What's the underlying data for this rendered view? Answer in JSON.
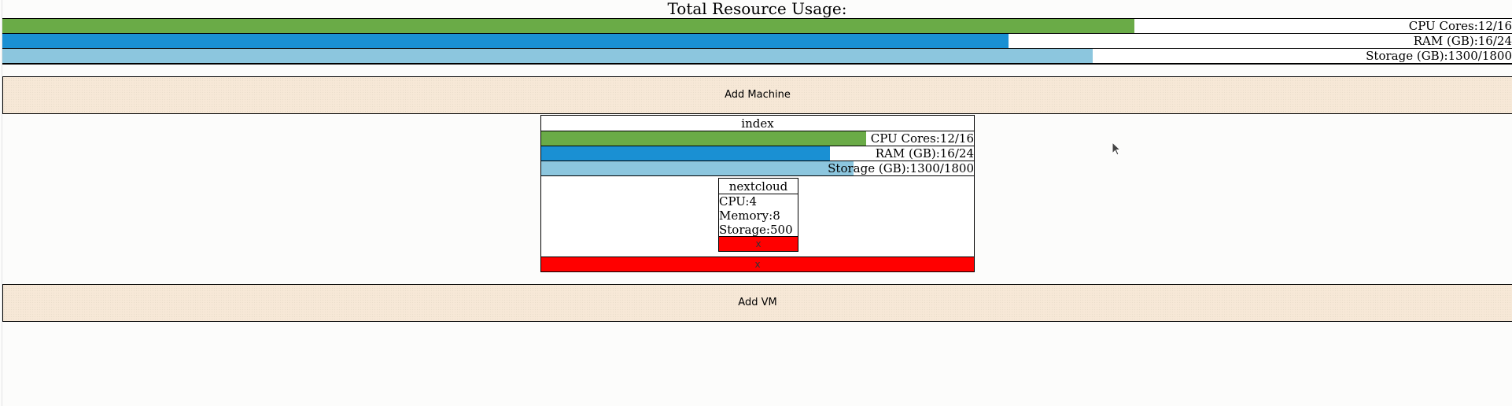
{
  "colors": {
    "cpu": "#6aab47",
    "ram": "#1a90d3",
    "storage": "#8cc6de",
    "delete": "#ff0000",
    "button_bg": "#f7e8d7"
  },
  "total": {
    "title": "Total Resource Usage:",
    "bars": [
      {
        "label": "CPU Cores:12/16",
        "fraction": 0.75,
        "color": "#6aab47"
      },
      {
        "label": "RAM (GB):16/24",
        "fraction": 0.6667,
        "color": "#1a90d3"
      },
      {
        "label": "Storage (GB):1300/1800",
        "fraction": 0.7222,
        "color": "#8cc6de"
      }
    ]
  },
  "add_machine_label": "Add Machine",
  "machine": {
    "title": "index",
    "bars": [
      {
        "label": "CPU Cores:12/16",
        "fraction": 0.75,
        "color": "#6aab47"
      },
      {
        "label": "RAM (GB):16/24",
        "fraction": 0.6667,
        "color": "#1a90d3"
      },
      {
        "label": "Storage (GB):1300/1800",
        "fraction": 0.7222,
        "color": "#8cc6de"
      }
    ],
    "vm": {
      "title": "nextcloud",
      "cpu": "CPU:4",
      "memory": "Memory:8",
      "storage": "Storage:500",
      "delete_label": "x"
    },
    "delete_label": "x"
  },
  "add_vm_label": "Add VM",
  "cursor_icon": "mouse-pointer-icon"
}
